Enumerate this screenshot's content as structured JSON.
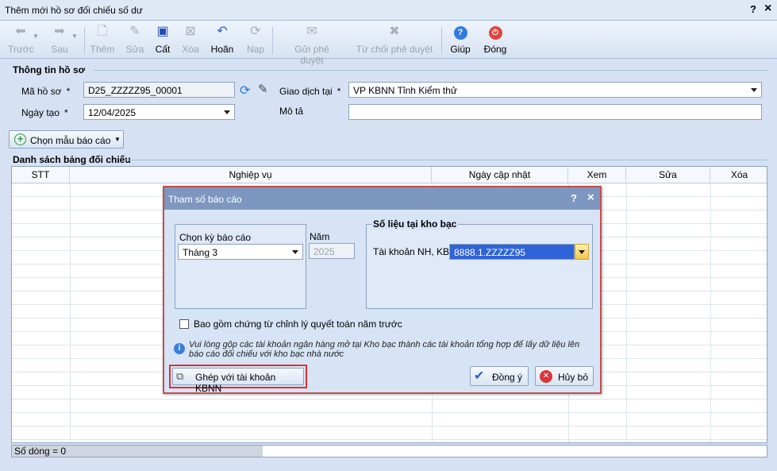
{
  "window": {
    "title": "Thêm mới hồ sơ đối chiếu số dư",
    "help": "?",
    "close": "×"
  },
  "toolbar": {
    "back": "Trước",
    "next": "Sau",
    "add": "Thêm",
    "edit": "Sửa",
    "save": "Cất",
    "delete": "Xóa",
    "undo": "Hoãn",
    "reload": "Nạp",
    "submit": "Gửi phê duyệt",
    "reject": "Từ chối phê duyệt",
    "help": "Giúp",
    "close": "Đóng"
  },
  "info": {
    "group_title": "Thông tin hồ sơ",
    "ma_ho_so_label": "Mã hồ sơ",
    "ma_ho_so_value": "D25_ZZZZZ95_00001",
    "giao_dich_label": "Giao dịch tại",
    "giao_dich_value": "VP KBNN Tỉnh Kiểm thử",
    "ngay_tao_label": "Ngày tạo",
    "ngay_tao_value": "12/04/2025",
    "mo_ta_label": "Mô tả",
    "mo_ta_value": "",
    "required": "*"
  },
  "template_button": "Chọn mẫu báo cáo",
  "list": {
    "group_title": "Danh sách bảng đối chiếu",
    "columns": [
      "STT",
      "Nghiệp vụ",
      "Ngày cập nhật",
      "Xem",
      "Sửa",
      "Xóa"
    ],
    "row_count_label": "Số dòng = 0"
  },
  "dialog": {
    "title": "Tham số báo cáo",
    "help": "?",
    "close": "×",
    "period_label": "Chọn kỳ báo cáo",
    "period_value": "Tháng 3",
    "year_label": "Năm",
    "year_value": "2025",
    "treasury_group": "Số liệu tại kho bạc",
    "account_label": "Tài khoản NH, KB",
    "account_value": "8888.1.ZZZZZ95",
    "include_label": "Bao gồm chứng từ chỉnh lý quyết toán năm trước",
    "note": "Vui lòng gộp các tài khoản ngân hàng mở tại Kho bạc thành các tài khoản tổng hợp để lấy dữ liệu lên báo cáo đối chiếu với kho bạc nhà nước",
    "merge_button": "Ghép với tài khoản KBNN",
    "ok_button": "Đồng ý",
    "cancel_button": "Hủy bỏ"
  },
  "colors": {
    "accent": "#2f63d8",
    "highlight": "#e03030",
    "dialog_title": "#7d97c0"
  }
}
